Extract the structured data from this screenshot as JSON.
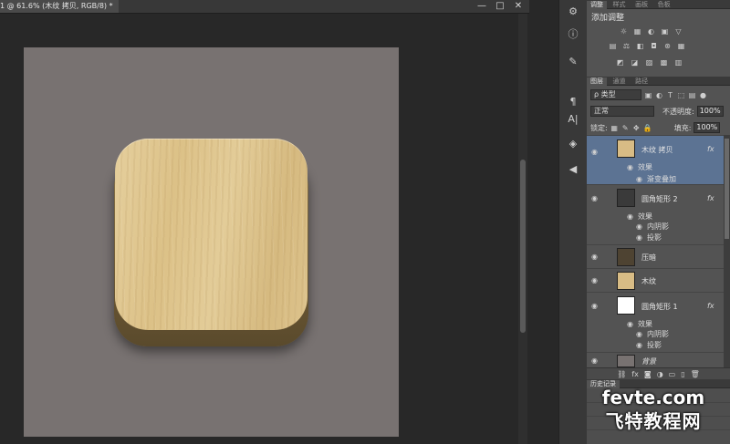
{
  "document": {
    "tab_title": "1 @ 61.6% (木纹 拷贝, RGB/8) *",
    "window_controls": [
      "—",
      "□",
      "✕"
    ]
  },
  "colors": {
    "artboard_bg": "#787271",
    "workspace_bg": "#282828",
    "wood_light": "#e3cc98",
    "wood_dark": "#6e5a35",
    "selected_layer": "#5c7393"
  },
  "tools": [
    "properties-icon",
    "info-icon",
    "brush-icon",
    "paragraph-icon",
    "character-icon",
    "3d-icon",
    "arrow-icon"
  ],
  "tool_glyphs": [
    "⚙",
    "ⓘ",
    "✎",
    "¶",
    "A|",
    "◈",
    "◀"
  ],
  "adjustments": {
    "tabs": [
      "调整",
      "样式",
      "画板",
      "色板"
    ],
    "title": "添加调整",
    "row1": [
      "☼",
      "▦",
      "◐",
      "▣",
      "▽"
    ],
    "row2": [
      "▤",
      "⚖",
      "◧",
      "◘",
      "⊛",
      "▦"
    ],
    "row3": [
      "◩",
      "◪",
      "▨",
      "▩",
      "▥"
    ]
  },
  "layers_panel": {
    "tabs": [
      "图层",
      "通道",
      "路径"
    ],
    "filter_label": "ρ 类型",
    "filter_icons": [
      "▣",
      "◐",
      "T",
      "⬚",
      "▤",
      "●"
    ],
    "blend_mode": "正常",
    "opacity_label": "不透明度:",
    "opacity_value": "100%",
    "lock_label": "锁定:",
    "lock_icons": [
      "▦",
      "✎",
      "✥",
      "🔒"
    ],
    "fill_label": "填充:",
    "fill_value": "100%",
    "layers": [
      {
        "name": "木纹 拷贝",
        "fx": "fx",
        "selected": true,
        "thumb": "#d8bc85",
        "effects_label": "效果",
        "effects": [
          "渐变叠加"
        ]
      },
      {
        "name": "圆角矩形 2",
        "fx": "fx",
        "selected": false,
        "thumb": "#3a3a3a",
        "effects_label": "效果",
        "effects": [
          "内阴影",
          "投影"
        ]
      },
      {
        "name": "压暗",
        "fx": "",
        "selected": false,
        "thumb": "#4e4332",
        "effects_label": "",
        "effects": []
      },
      {
        "name": "木纹",
        "fx": "",
        "selected": false,
        "thumb": "#d8bc85",
        "effects_label": "",
        "effects": []
      },
      {
        "name": "圆角矩形 1",
        "fx": "fx",
        "selected": false,
        "thumb": "#ffffff",
        "effects_label": "效果",
        "effects": [
          "内阴影",
          "投影"
        ]
      },
      {
        "name": "背景",
        "fx": "",
        "selected": false,
        "thumb": "#787271",
        "effects_label": "",
        "effects": []
      }
    ],
    "footer_icons": [
      "⛓",
      "fx",
      "◙",
      "◑",
      "▭",
      "▯",
      "🗑"
    ]
  },
  "history_panel": {
    "tabs": [
      "历史记录"
    ],
    "items": [
      "",
      "",
      ""
    ]
  },
  "watermark": {
    "line1": "fevte.com",
    "line2": "飞特教程网"
  }
}
